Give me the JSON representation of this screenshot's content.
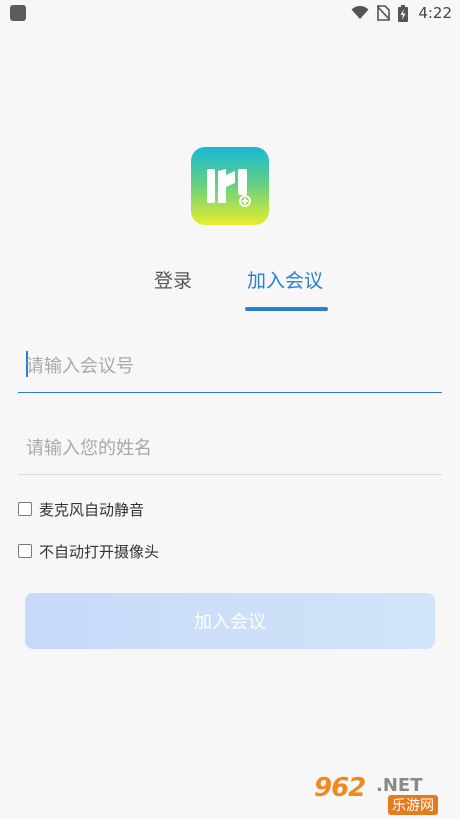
{
  "status_bar": {
    "time": "4:22",
    "icons": [
      "notification-icon",
      "wifi-icon",
      "no-sim-icon",
      "battery-charging-icon"
    ]
  },
  "logo": {
    "name": "app-logo",
    "letter": "M"
  },
  "tabs": [
    {
      "label": "登录",
      "active": false
    },
    {
      "label": "加入会议",
      "active": true
    }
  ],
  "form": {
    "meeting_id": {
      "placeholder": "请输入会议号",
      "value": ""
    },
    "name": {
      "placeholder": "请输入您的姓名",
      "value": ""
    }
  },
  "options": [
    {
      "label": "麦克风自动静音",
      "checked": false
    },
    {
      "label": "不自动打开摄像头",
      "checked": false
    }
  ],
  "join_button": {
    "label": "加入会议",
    "enabled": false
  },
  "watermark": {
    "number": "962",
    "domain": ".NET",
    "site": "乐游网"
  },
  "colors": {
    "accent": "#2a7fd0",
    "button_disabled": "#c7d9f8",
    "background": "#f7f7f8"
  }
}
